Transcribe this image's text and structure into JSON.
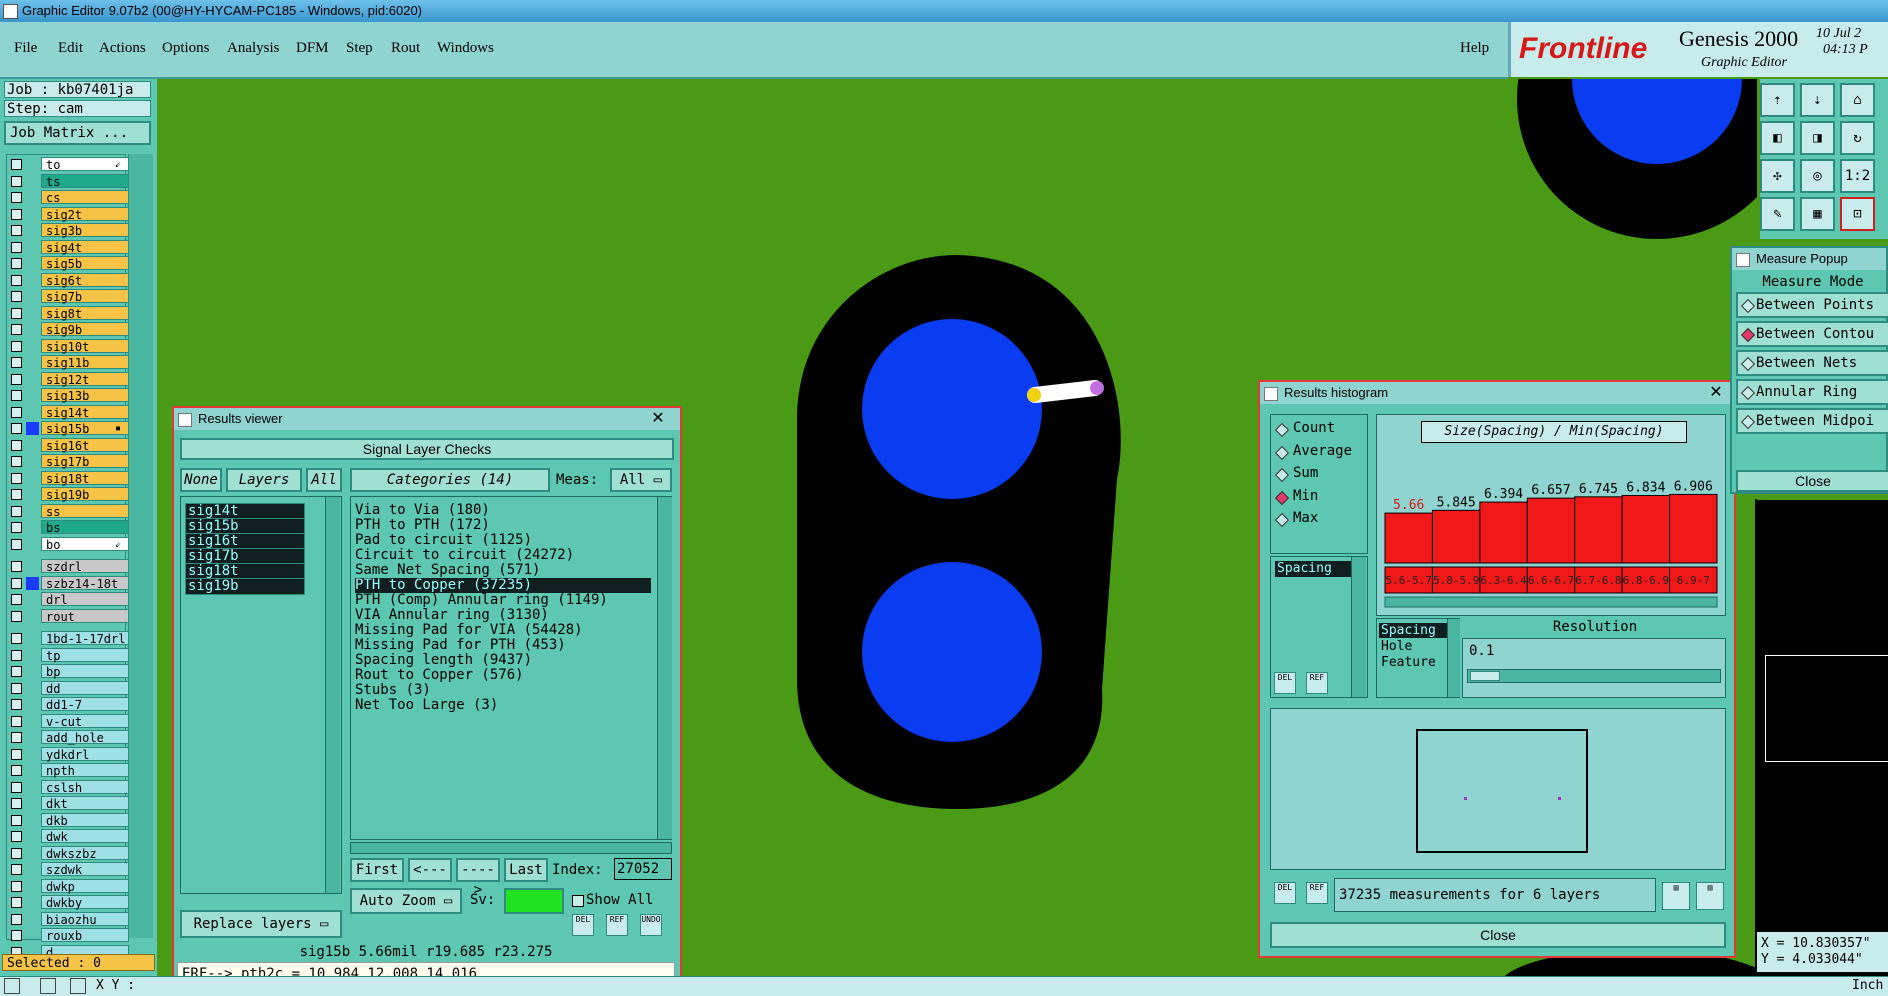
{
  "window": {
    "title": "Graphic Editor 9.07b2 (00@HY-HYCAM-PC185 - Windows, pid:6020)"
  },
  "menu": {
    "items": [
      "File",
      "Edit",
      "Actions",
      "Options",
      "Analysis",
      "DFM",
      "Step",
      "Rout",
      "Windows"
    ],
    "help": "Help"
  },
  "logo": {
    "brand": "Frontline",
    "product": "Genesis 2000",
    "subtitle": "Graphic Editor",
    "date": "10 Jul 2",
    "time": "04:13 P"
  },
  "job": {
    "job_label": "Job : kb07401ja",
    "step_label": "Step: cam",
    "matrix_button": "Job Matrix ..."
  },
  "layers": [
    {
      "name": "to",
      "color": "#ffffff",
      "mark": "⇙"
    },
    {
      "name": "ts",
      "color": "#20a88a"
    },
    {
      "name": "cs",
      "color": "#f6c346"
    },
    {
      "name": "sig2t",
      "color": "#f6c346"
    },
    {
      "name": "sig3b",
      "color": "#f6c346"
    },
    {
      "name": "sig4t",
      "color": "#f6c346"
    },
    {
      "name": "sig5b",
      "color": "#f6c346"
    },
    {
      "name": "sig6t",
      "color": "#f6c346"
    },
    {
      "name": "sig7b",
      "color": "#f6c346"
    },
    {
      "name": "sig8t",
      "color": "#f6c346"
    },
    {
      "name": "sig9b",
      "color": "#f6c346"
    },
    {
      "name": "sig10t",
      "color": "#f6c346"
    },
    {
      "name": "sig11b",
      "color": "#f6c346"
    },
    {
      "name": "sig12t",
      "color": "#f6c346"
    },
    {
      "name": "sig13b",
      "color": "#f6c346"
    },
    {
      "name": "sig14t",
      "color": "#f6c346"
    },
    {
      "name": "sig15b",
      "color": "#f6c346",
      "mark": "▪",
      "swatch": "#1a3aff"
    },
    {
      "name": "sig16t",
      "color": "#f6c346"
    },
    {
      "name": "sig17b",
      "color": "#f6c346"
    },
    {
      "name": "sig18t",
      "color": "#f6c346"
    },
    {
      "name": "sig19b",
      "color": "#f6c346"
    },
    {
      "name": "ss",
      "color": "#f6c346"
    },
    {
      "name": "bs",
      "color": "#20a88a"
    },
    {
      "name": "bo",
      "color": "#ffffff",
      "mark": "⇙"
    },
    {
      "name": "szdrl",
      "color": "#c8c8c8",
      "gap": true
    },
    {
      "name": "szbz14-18t",
      "color": "#c8c8c8",
      "swatch": "#1a3aff"
    },
    {
      "name": "drl",
      "color": "#c8c8c8"
    },
    {
      "name": "rout",
      "color": "#c8c8c8"
    },
    {
      "name": "1bd-1-17drl",
      "color": "#9fe0e6",
      "gap": true
    },
    {
      "name": "tp",
      "color": "#9fe0e6"
    },
    {
      "name": "bp",
      "color": "#9fe0e6"
    },
    {
      "name": "dd",
      "color": "#9fe0e6"
    },
    {
      "name": "dd1-7",
      "color": "#9fe0e6"
    },
    {
      "name": "v-cut",
      "color": "#9fe0e6"
    },
    {
      "name": "add_hole",
      "color": "#9fe0e6"
    },
    {
      "name": "ydkdrl",
      "color": "#9fe0e6"
    },
    {
      "name": "npth",
      "color": "#9fe0e6"
    },
    {
      "name": "cslsh",
      "color": "#9fe0e6"
    },
    {
      "name": "dkt",
      "color": "#9fe0e6"
    },
    {
      "name": "dkb",
      "color": "#9fe0e6"
    },
    {
      "name": "dwk",
      "color": "#9fe0e6"
    },
    {
      "name": "dwkszbz",
      "color": "#9fe0e6"
    },
    {
      "name": "szdwk",
      "color": "#9fe0e6"
    },
    {
      "name": "dwkp",
      "color": "#9fe0e6"
    },
    {
      "name": "dwkby",
      "color": "#9fe0e6"
    },
    {
      "name": "biaozhu",
      "color": "#9fe0e6"
    },
    {
      "name": "rouxb",
      "color": "#9fe0e6"
    },
    {
      "name": "d",
      "color": "#9fe0e6"
    }
  ],
  "selected": "Selected : 0",
  "results_viewer": {
    "title": "Results viewer",
    "heading": "Signal Layer Checks",
    "buttons": {
      "none": "None",
      "layers": "Layers",
      "all": "All",
      "categories": "Categories (14)",
      "meas_label": "Meas:",
      "meas_value": "All"
    },
    "layer_items": [
      "sig14t",
      "sig15b",
      "sig16t",
      "sig17b",
      "sig18t",
      "sig19b"
    ],
    "categories": [
      "Via to Via (180)",
      "PTH to PTH (172)",
      "Pad to circuit (1125)",
      "Circuit to circuit (24272)",
      "Same Net Spacing (571)",
      "PTH to Copper (37235)",
      "PTH (Comp) Annular ring (1149)",
      "VIA Annular ring (3130)",
      "Missing Pad for VIA (54428)",
      "Missing Pad for PTH (453)",
      "Spacing length (9437)",
      "Rout to Copper (576)",
      "Stubs (3)",
      "Net Too Large (3)"
    ],
    "selected_category": 5,
    "nav": {
      "first": "First",
      "prev": "<----",
      "next": "---->",
      "last": "Last",
      "index_label": "Index:",
      "index_value": "27052"
    },
    "zoom": "Auto Zoom",
    "sv_label": "Sv:",
    "show_all": "Show All",
    "replace": "Replace layers",
    "status": "sig15b 5.66mil  r19.685  r23.275",
    "erf": "ERF--> pth2c = 10.984 12.008 14.016"
  },
  "histogram": {
    "title": "Results histogram",
    "modes": [
      "Count",
      "Average",
      "Sum",
      "Min",
      "Max"
    ],
    "selected_mode": 3,
    "list_item": "Spacing",
    "chart_title": "Size(Spacing) / Min(Spacing)",
    "fields": [
      "Spacing",
      "Hole",
      "Feature"
    ],
    "resolution_label": "Resolution",
    "resolution_value": "0.1",
    "summary": "37235 measurements for 6 layers",
    "close": "Close"
  },
  "chart_data": {
    "type": "bar",
    "title": "Size(Spacing) / Min(Spacing)",
    "categories": [
      "5.6-5.7",
      "5.8-5.9",
      "6.3-6.4",
      "6.6-6.7",
      "6.7-6.8",
      "6.8-6.9",
      "6.9-7"
    ],
    "values": [
      5.66,
      5.845,
      6.394,
      6.657,
      6.745,
      6.834,
      6.906
    ],
    "value_labels": [
      "5.66",
      "5.845",
      "6.394",
      "6.657",
      "6.745",
      "6.834",
      "6.906"
    ],
    "ylim": [
      5.0,
      7.0
    ],
    "highlight_color": "#f01818"
  },
  "measure_popup": {
    "title": "Measure Popup",
    "mode_label": "Measure Mode",
    "modes": [
      "Between Points",
      "Between Contou",
      "Between Nets",
      "Annular Ring",
      "Between Midpoi"
    ],
    "selected_mode": 1,
    "close": "Close"
  },
  "coords": {
    "x": "X = 10.830357\"",
    "y": "Y = 4.033044\""
  },
  "toolbar_icons": [
    "import-icon",
    "export-icon",
    "home-icon",
    "left-icon",
    "right-icon",
    "rotate-icon",
    "fit-icon",
    "center-icon",
    "ratio-icon",
    "draw-icon",
    "grid-icon",
    "snap-icon"
  ],
  "toolbar_texts": {
    "ratio": "1:2"
  },
  "bottom": {
    "xy": "X Y :",
    "units": "Inch"
  }
}
